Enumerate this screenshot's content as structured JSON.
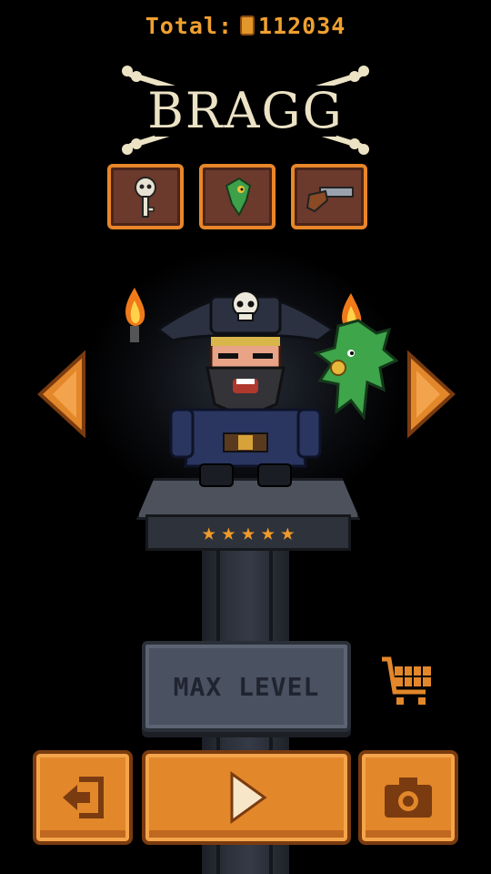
{
  "header": {
    "total_label": "Total:",
    "total_value": "112034"
  },
  "character": {
    "name": "BRAGG",
    "stars": 5
  },
  "items": [
    "key-icon",
    "parrot-icon",
    "pistol-icon"
  ],
  "buttons": {
    "max_level_label": "MAX LEVEL"
  },
  "colors": {
    "accent": "#e2872a",
    "gold_text": "#f0a030",
    "title": "#ece3c5",
    "disabled_button": "#4a5160"
  },
  "icons": {
    "prev": "arrow-left-icon",
    "next": "arrow-right-icon",
    "shop": "shopping-cart-icon",
    "exit": "exit-icon",
    "play": "play-icon",
    "camera": "camera-icon"
  }
}
